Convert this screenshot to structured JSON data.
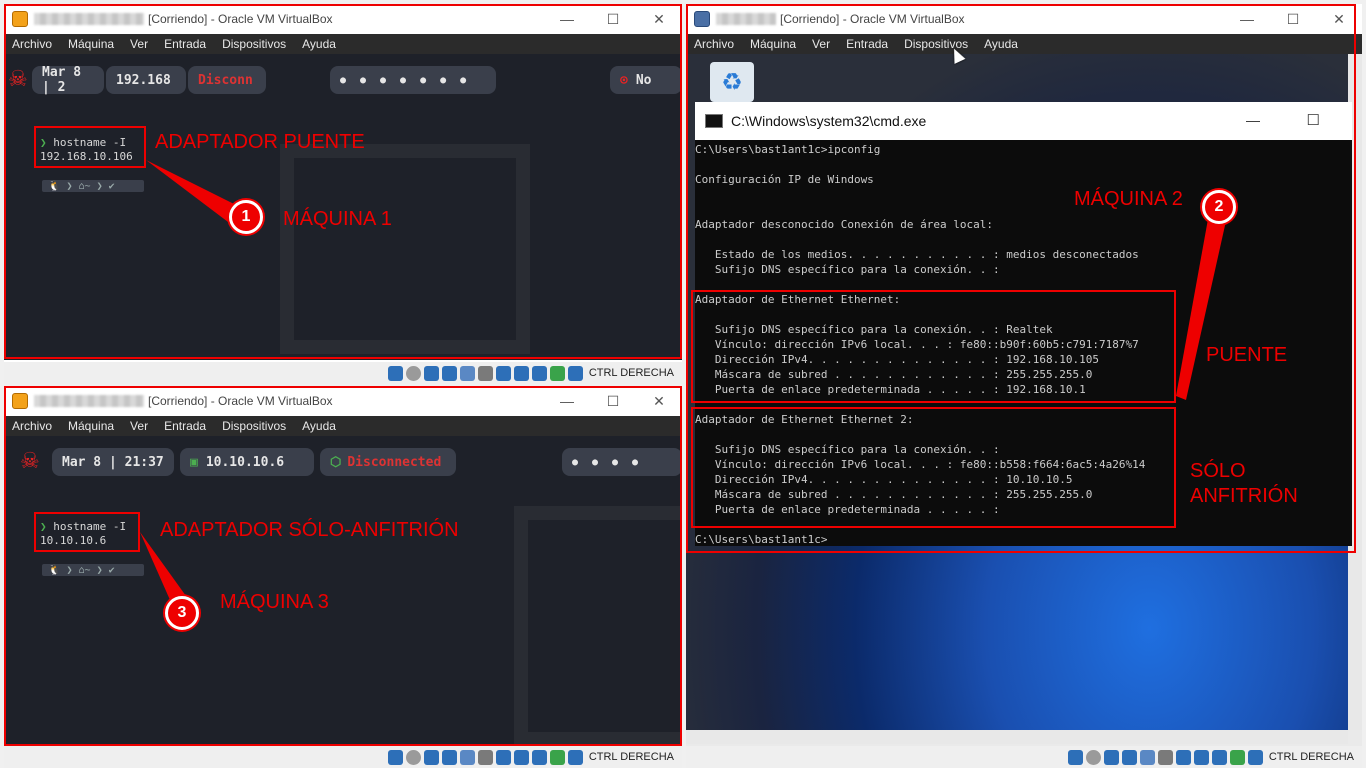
{
  "vm1": {
    "title_suffix": "[Corriendo] - Oracle VM VirtualBox",
    "menu": [
      "Archivo",
      "Máquina",
      "Ver",
      "Entrada",
      "Dispositivos",
      "Ayuda"
    ],
    "date": "Mar 8 | 2",
    "ip_pill": "192.168",
    "net_pill": "Disconn",
    "right_pill": "No",
    "prompt_cmd": "hostname -I",
    "prompt_out": "192.168.10.106",
    "annot_adapter": "ADAPTADOR PUENTE",
    "annot_machine": "MÁQUINA 1",
    "badge": "1",
    "status_text": "CTRL DERECHA"
  },
  "vm3": {
    "title_suffix": "[Corriendo] - Oracle VM VirtualBox",
    "menu": [
      "Archivo",
      "Máquina",
      "Ver",
      "Entrada",
      "Dispositivos",
      "Ayuda"
    ],
    "date": "Mar 8 | 21:37",
    "ip_pill": "10.10.10.6",
    "net_pill": "Disconnected",
    "prompt_cmd": "hostname -I",
    "prompt_out": "10.10.10.6",
    "annot_adapter": "ADAPTADOR SÓLO-ANFITRIÓN",
    "annot_machine": "MÁQUINA 3",
    "badge": "3",
    "status_text": "CTRL DERECHA"
  },
  "vm2": {
    "title_suffix": "[Corriendo] - Oracle VM VirtualBox",
    "menu": [
      "Archivo",
      "Máquina",
      "Ver",
      "Entrada",
      "Dispositivos",
      "Ayuda"
    ],
    "cmd_title": "C:\\Windows\\system32\\cmd.exe",
    "cmd_lines": [
      "C:\\Users\\bast1ant1c>ipconfig",
      "",
      "Configuración IP de Windows",
      "",
      "",
      "Adaptador desconocido Conexión de área local:",
      "",
      "   Estado de los medios. . . . . . . . . . . : medios desconectados",
      "   Sufijo DNS específico para la conexión. . :",
      "",
      "Adaptador de Ethernet Ethernet:",
      "",
      "   Sufijo DNS específico para la conexión. . : Realtek",
      "   Vínculo: dirección IPv6 local. . . : fe80::b90f:60b5:c791:7187%7",
      "   Dirección IPv4. . . . . . . . . . . . . . : 192.168.10.105",
      "   Máscara de subred . . . . . . . . . . . . : 255.255.255.0",
      "   Puerta de enlace predeterminada . . . . . : 192.168.10.1",
      "",
      "Adaptador de Ethernet Ethernet 2:",
      "",
      "   Sufijo DNS específico para la conexión. . :",
      "   Vínculo: dirección IPv6 local. . . : fe80::b558:f664:6ac5:4a26%14",
      "   Dirección IPv4. . . . . . . . . . . . . . : 10.10.10.5",
      "   Máscara de subred . . . . . . . . . . . . : 255.255.255.0",
      "   Puerta de enlace predeterminada . . . . . :",
      "",
      "C:\\Users\\bast1ant1c>"
    ],
    "annot_machine": "MÁQUINA 2",
    "annot_puente": "PUENTE",
    "annot_solo": "SÓLO\nANFITRIÓN",
    "badge": "2",
    "status_text": "CTRL DERECHA"
  },
  "colors": {
    "annotation": "#e00000",
    "terminal_bg": "#1e2129",
    "cmd_bg": "#0c0c0c"
  }
}
